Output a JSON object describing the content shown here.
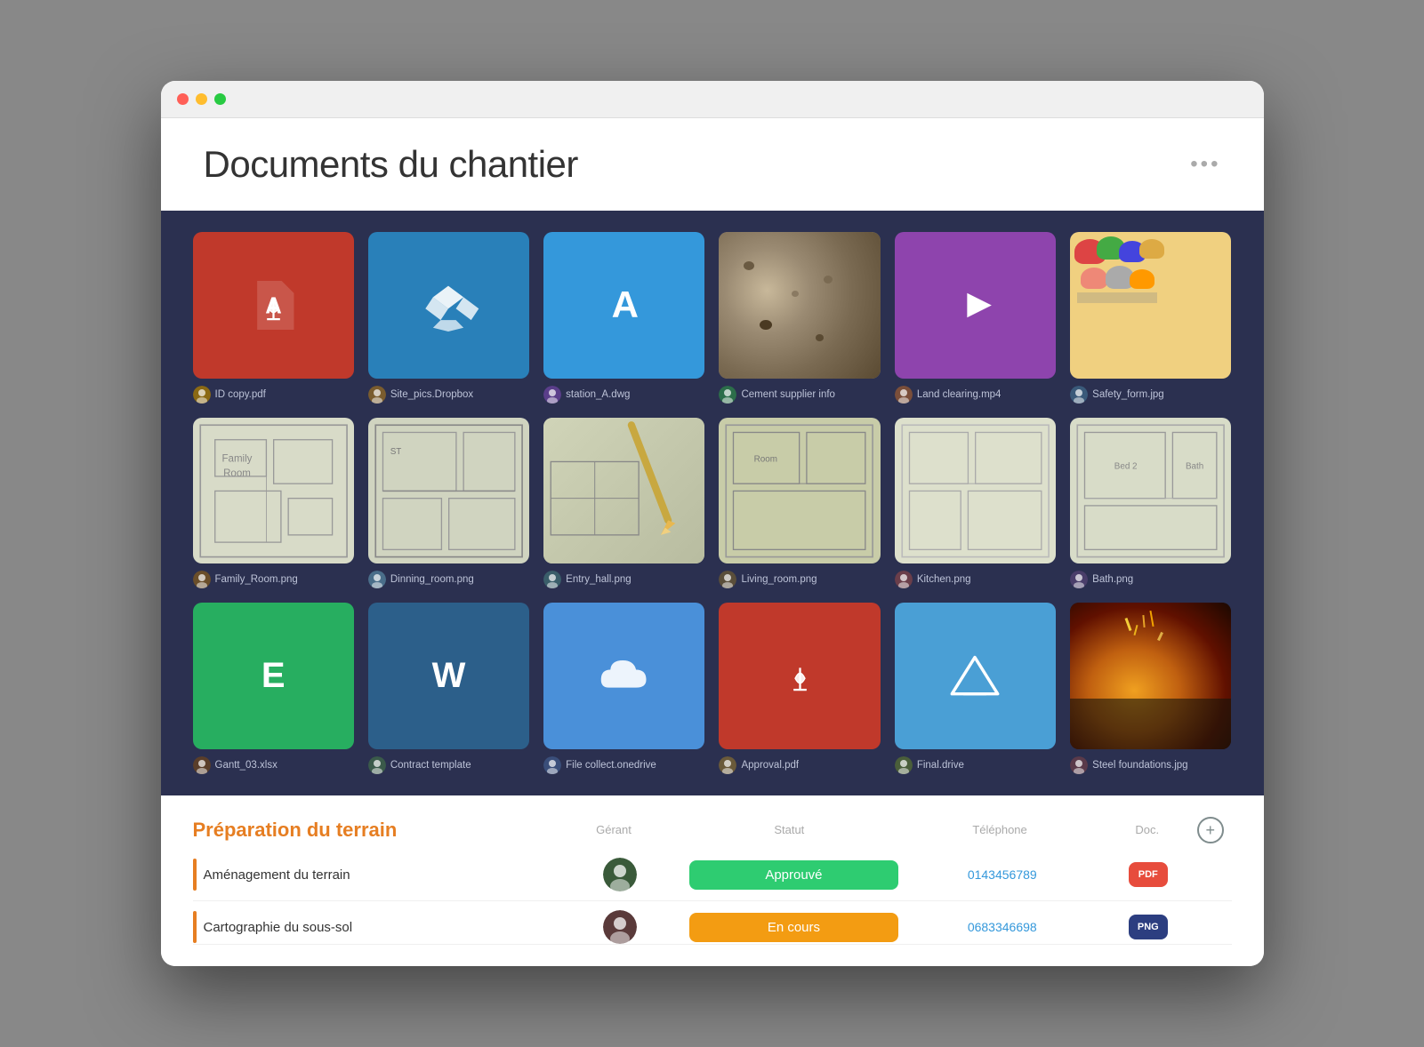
{
  "window": {
    "title": "Documents du chantier"
  },
  "header": {
    "title": "Documents du chantier",
    "more_icon": "•••"
  },
  "files": [
    {
      "id": 1,
      "name": "ID copy.pdf",
      "type": "pdf",
      "bg": "bg-red",
      "icon": "pdf",
      "avatar_color": "#8B6914"
    },
    {
      "id": 2,
      "name": "Site_pics.Dropbox",
      "type": "dropbox",
      "bg": "bg-blue",
      "icon": "dropbox",
      "avatar_color": "#7A5C2E"
    },
    {
      "id": 3,
      "name": "station_A.dwg",
      "type": "dwg",
      "bg": "bg-cyan",
      "icon": "dwg",
      "avatar_color": "#5A3E8A"
    },
    {
      "id": 4,
      "name": "Cement supplier info",
      "type": "photo",
      "bg": "photo",
      "photo": "cement",
      "avatar_color": "#2C6E4A"
    },
    {
      "id": 5,
      "name": "Land clearing.mp4",
      "type": "video",
      "bg": "bg-purple",
      "icon": "video",
      "avatar_color": "#7A4E3A"
    },
    {
      "id": 6,
      "name": "Safety_form.jpg",
      "type": "photo",
      "bg": "photo",
      "photo": "safety",
      "avatar_color": "#3A5A7A"
    },
    {
      "id": 7,
      "name": "Family_Room.png",
      "type": "blueprint",
      "bg": "blueprint",
      "avatar_color": "#6A4E2A"
    },
    {
      "id": 8,
      "name": "Dinning_room.png",
      "type": "blueprint",
      "bg": "blueprint",
      "avatar_color": "#4A6E8A"
    },
    {
      "id": 9,
      "name": "Entry_hall.png",
      "type": "blueprint",
      "bg": "blueprint",
      "avatar_color": "#3A5E6A"
    },
    {
      "id": 10,
      "name": "Living_room.png",
      "type": "blueprint",
      "bg": "blueprint",
      "avatar_color": "#5A4E3A"
    },
    {
      "id": 11,
      "name": "Kitchen.png",
      "type": "blueprint",
      "bg": "blueprint",
      "avatar_color": "#6A3E4A"
    },
    {
      "id": 12,
      "name": "Bath.png",
      "type": "blueprint",
      "bg": "blueprint",
      "avatar_color": "#4A3E6A"
    },
    {
      "id": 13,
      "name": "Gantt_03.xlsx",
      "type": "excel",
      "bg": "bg-green",
      "icon": "excel",
      "avatar_color": "#5A3E2A"
    },
    {
      "id": 14,
      "name": "Contract template",
      "type": "word",
      "bg": "bg-darkblue",
      "icon": "word",
      "avatar_color": "#3A5A4A"
    },
    {
      "id": 15,
      "name": "File collect.onedrive",
      "type": "onedrive",
      "bg": "bg-lightblue",
      "icon": "onedrive",
      "avatar_color": "#3A4E7A"
    },
    {
      "id": 16,
      "name": "Approval.pdf",
      "type": "pdf",
      "bg": "bg-red",
      "icon": "pdf",
      "avatar_color": "#6A5A3A"
    },
    {
      "id": 17,
      "name": "Final.drive",
      "type": "drive",
      "bg": "bg-skyblue",
      "icon": "drive",
      "avatar_color": "#4A5E3A"
    },
    {
      "id": 18,
      "name": "Steel foundations.jpg",
      "type": "photo",
      "bg": "photo",
      "photo": "steel",
      "avatar_color": "#5A3A4A"
    }
  ],
  "table": {
    "section_title": "Préparation du terrain",
    "columns": {
      "task": "",
      "gerant": "Gérant",
      "statut": "Statut",
      "telephone": "Téléphone",
      "doc": "Doc.",
      "add": ""
    },
    "rows": [
      {
        "task": "Aménagement du terrain",
        "statut": "Approuvé",
        "statut_color": "status-green",
        "telephone": "0143456789",
        "doc_type": "PDF",
        "doc_color": "doc-pdf"
      },
      {
        "task": "Cartographie du sous-sol",
        "statut": "En cours",
        "statut_color": "status-orange",
        "telephone": "0683346698",
        "doc_type": "PNG",
        "doc_color": "doc-png"
      }
    ]
  }
}
